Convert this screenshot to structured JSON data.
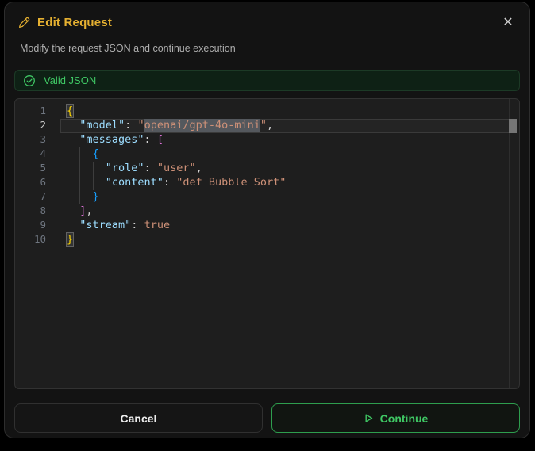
{
  "dialog": {
    "title": "Edit Request",
    "subtitle": "Modify the request JSON and continue execution",
    "close_icon": "✕"
  },
  "status": {
    "label": "Valid JSON"
  },
  "editor": {
    "lines": [
      {
        "num": "1",
        "active": false,
        "guides": [],
        "tokens": [
          {
            "t": "{",
            "c": "b1",
            "f": "m"
          }
        ]
      },
      {
        "num": "2",
        "active": true,
        "guides": [
          0
        ],
        "tokens": [
          {
            "t": "  ",
            "c": ""
          },
          {
            "t": "\"model\"",
            "c": "key"
          },
          {
            "t": ": ",
            "c": "pun"
          },
          {
            "t": "\"",
            "c": "str"
          },
          {
            "t": "openai/gpt-4o-mini",
            "c": "str",
            "f": "sel cur"
          },
          {
            "t": "\"",
            "c": "str"
          },
          {
            "t": ",",
            "c": "pun"
          }
        ]
      },
      {
        "num": "3",
        "active": false,
        "guides": [
          0
        ],
        "tokens": [
          {
            "t": "  ",
            "c": ""
          },
          {
            "t": "\"messages\"",
            "c": "key"
          },
          {
            "t": ": ",
            "c": "pun"
          },
          {
            "t": "[",
            "c": "b2"
          }
        ]
      },
      {
        "num": "4",
        "active": false,
        "guides": [
          0,
          2
        ],
        "tokens": [
          {
            "t": "    ",
            "c": ""
          },
          {
            "t": "{",
            "c": "b3"
          }
        ]
      },
      {
        "num": "5",
        "active": false,
        "guides": [
          0,
          2,
          4
        ],
        "tokens": [
          {
            "t": "      ",
            "c": ""
          },
          {
            "t": "\"role\"",
            "c": "key"
          },
          {
            "t": ": ",
            "c": "pun"
          },
          {
            "t": "\"user\"",
            "c": "str"
          },
          {
            "t": ",",
            "c": "pun"
          }
        ]
      },
      {
        "num": "6",
        "active": false,
        "guides": [
          0,
          2,
          4
        ],
        "tokens": [
          {
            "t": "      ",
            "c": ""
          },
          {
            "t": "\"content\"",
            "c": "key"
          },
          {
            "t": ": ",
            "c": "pun"
          },
          {
            "t": "\"def Bubble Sort\"",
            "c": "str"
          }
        ]
      },
      {
        "num": "7",
        "active": false,
        "guides": [
          0,
          2
        ],
        "tokens": [
          {
            "t": "    ",
            "c": ""
          },
          {
            "t": "}",
            "c": "b3"
          }
        ]
      },
      {
        "num": "8",
        "active": false,
        "guides": [
          0
        ],
        "tokens": [
          {
            "t": "  ",
            "c": ""
          },
          {
            "t": "]",
            "c": "b2"
          },
          {
            "t": ",",
            "c": "pun"
          }
        ]
      },
      {
        "num": "9",
        "active": false,
        "guides": [
          0
        ],
        "tokens": [
          {
            "t": "  ",
            "c": ""
          },
          {
            "t": "\"stream\"",
            "c": "key"
          },
          {
            "t": ": ",
            "c": "pun"
          },
          {
            "t": "true",
            "c": "bool"
          }
        ]
      },
      {
        "num": "10",
        "active": false,
        "guides": [],
        "tokens": [
          {
            "t": "}",
            "c": "b1",
            "f": "m"
          }
        ]
      }
    ]
  },
  "footer": {
    "cancel_label": "Cancel",
    "continue_label": "Continue"
  },
  "colors": {
    "title_accent": "#e5b031",
    "success_green": "#3fc764",
    "continue_border": "#2e9e4e",
    "editor_background": "#1e1e1e",
    "selection": "#54585d",
    "json_key": "#9cdcfe",
    "json_string": "#ce9178",
    "bracket_level1": "#ffd700",
    "bracket_level2": "#da70d6",
    "bracket_level3": "#179fff"
  }
}
